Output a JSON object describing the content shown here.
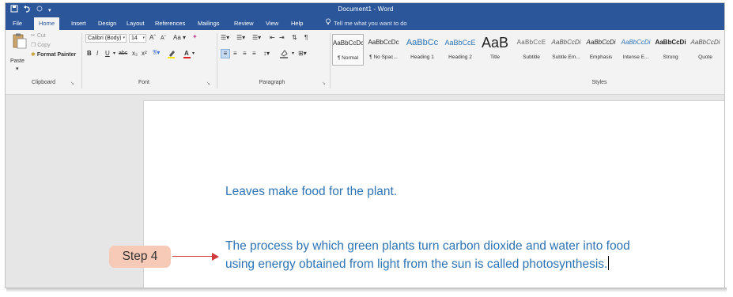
{
  "app": {
    "doc_title": "Document1 - Word"
  },
  "quick_access": {
    "save_icon": "save-icon",
    "undo_icon": "undo-icon",
    "redo_icon": "redo-icon",
    "customize_icon": "customize-icon"
  },
  "tabs": [
    {
      "label": "File"
    },
    {
      "label": "Home"
    },
    {
      "label": "Insert"
    },
    {
      "label": "Design"
    },
    {
      "label": "Layout"
    },
    {
      "label": "References"
    },
    {
      "label": "Mailings"
    },
    {
      "label": "Review"
    },
    {
      "label": "View"
    },
    {
      "label": "Help"
    }
  ],
  "tellme": {
    "placeholder": "Tell me what you want to do"
  },
  "clipboard": {
    "paste": "Paste",
    "cut": "Cut",
    "copy": "Copy",
    "format_painter": "Format Painter",
    "label": "Clipboard"
  },
  "font": {
    "family": "Calibri (Body)",
    "size": "14",
    "grow": "Aˆ",
    "shrink": "Aˇ",
    "case": "Aa",
    "bold": "B",
    "italic": "I",
    "underline": "U",
    "strike": "abc",
    "subscript": "x₂",
    "superscript": "x²",
    "label": "Font"
  },
  "paragraph": {
    "label": "Paragraph",
    "pilcrow": "¶"
  },
  "styles": {
    "label": "Styles",
    "items": [
      {
        "preview": "AaBbCcDc",
        "name": "¶ Normal"
      },
      {
        "preview": "AaBbCcDc",
        "name": "¶ No Spac..."
      },
      {
        "preview": "AaBbCc",
        "name": "Heading 1"
      },
      {
        "preview": "AaBbCcE",
        "name": "Heading 2"
      },
      {
        "preview": "AaB",
        "name": "Title"
      },
      {
        "preview": "AaBbCcE",
        "name": "Subtitle"
      },
      {
        "preview": "AaBbCcDi",
        "name": "Subtle Em..."
      },
      {
        "preview": "AaBbCcDi",
        "name": "Emphasis"
      },
      {
        "preview": "AaBbCcDi",
        "name": "Intense E..."
      },
      {
        "preview": "AaBbCcDi",
        "name": "Strong"
      },
      {
        "preview": "AaBbCcDi",
        "name": "Quote"
      }
    ]
  },
  "document": {
    "line1": "Leaves make food for the plant.",
    "line2": "The process by which green plants turn carbon dioxide and water into food",
    "line3": "using energy obtained from light from the sun is called photosynthesis."
  },
  "annotation": {
    "step_label": "Step 4"
  },
  "colors": {
    "titlebar": "#2b579a",
    "body_text": "#2e74b5",
    "badge_bg": "#f7c9b7",
    "arrow": "#d13a3a"
  }
}
